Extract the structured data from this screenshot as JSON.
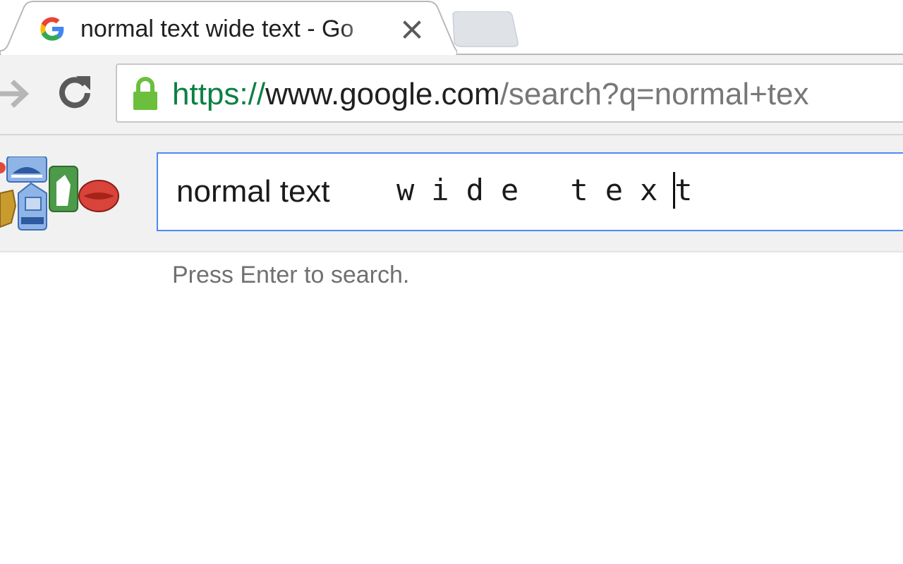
{
  "browser": {
    "tab": {
      "title": "normal text wide text - Go",
      "favicon": "google-g-icon"
    },
    "address_bar": {
      "scheme": "https://",
      "host": "www.google.com",
      "path": "/search?q=normal+tex",
      "lock_color": "#6cbf3c"
    }
  },
  "search": {
    "query_normal": "normal text",
    "query_wide": "wide text",
    "hint": "Press Enter to search.",
    "focus_color": "#4a8af4"
  }
}
